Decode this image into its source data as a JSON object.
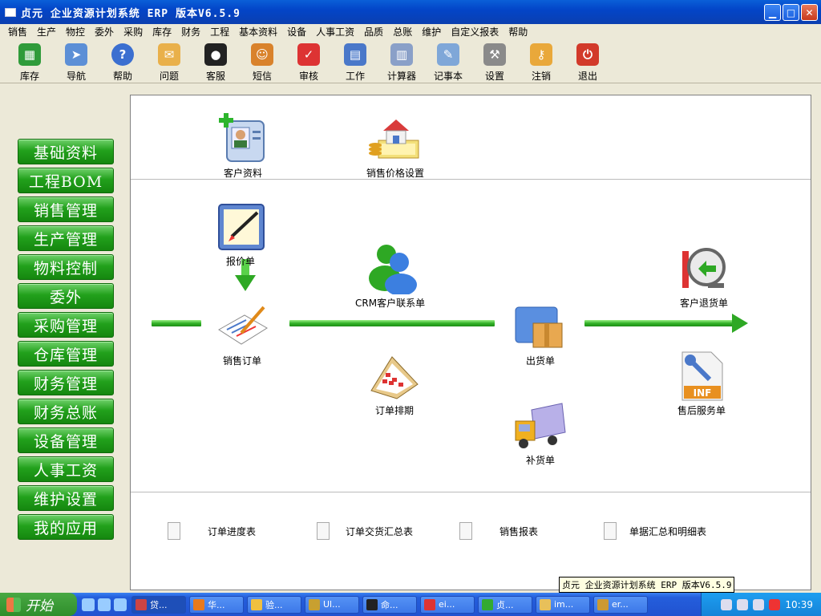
{
  "window": {
    "title": "贞元 企业资源计划系统 ERP 版本V6.5.9"
  },
  "menu": [
    "销售",
    "生产",
    "物控",
    "委外",
    "采购",
    "库存",
    "财务",
    "工程",
    "基本资料",
    "设备",
    "人事工资",
    "品质",
    "总账",
    "维护",
    "自定义报表",
    "帮助"
  ],
  "toolbar": [
    {
      "label": "库存",
      "icon": "inventory-icon",
      "color": "#2f9b3a"
    },
    {
      "label": "导航",
      "icon": "navigation-icon",
      "color": "#5c8fd6"
    },
    {
      "label": "帮助",
      "icon": "help-icon",
      "color": "#3b6fd0"
    },
    {
      "label": "问题",
      "icon": "envelope-icon",
      "color": "#e9b04a"
    },
    {
      "label": "客服",
      "icon": "qq-penguin-icon",
      "color": "#222222"
    },
    {
      "label": "短信",
      "icon": "people-icon",
      "color": "#d9822b"
    },
    {
      "label": "审核",
      "icon": "calendar-check-icon",
      "color": "#d33"
    },
    {
      "label": "工作",
      "icon": "calendar-icon",
      "color": "#4a78c9"
    },
    {
      "label": "计算器",
      "icon": "calculator-icon",
      "color": "#8aa0c8"
    },
    {
      "label": "记事本",
      "icon": "notepad-icon",
      "color": "#7fa7d8"
    },
    {
      "label": "设置",
      "icon": "tools-icon",
      "color": "#8a8a8a"
    },
    {
      "label": "注销",
      "icon": "key-icon",
      "color": "#e9a83a"
    },
    {
      "label": "退出",
      "icon": "power-icon",
      "color": "#d23a2a"
    }
  ],
  "nav": [
    "基础资料",
    "工程BOM",
    "销售管理",
    "生产管理",
    "物料控制",
    "委外",
    "采购管理",
    "仓库管理",
    "财务管理",
    "财务总账",
    "设备管理",
    "人事工资",
    "维护设置",
    "我的应用"
  ],
  "top_items": [
    {
      "label": "客户资料",
      "icon": "customer-card-icon"
    },
    {
      "label": "销售价格设置",
      "icon": "price-setting-icon"
    }
  ],
  "flow": {
    "quote": "报价单",
    "order": "销售订单",
    "crm": "CRM客户联系单",
    "schedule": "订单排期",
    "shipment": "出货单",
    "replenish": "补货单",
    "return": "客户退货单",
    "service": "售后服务单"
  },
  "reports": [
    "订单进度表",
    "订单交货汇总表",
    "销售报表",
    "单据汇总和明细表"
  ],
  "tooltip": "贞元 企业资源计划系统 ERP 版本V6.5.9",
  "taskbar": {
    "start": "开始",
    "tasks": [
      {
        "label": "贷...",
        "color": "#c44"
      },
      {
        "label": "华...",
        "color": "#e87a1e"
      },
      {
        "label": "验...",
        "color": "#f0c040"
      },
      {
        "label": "Ul...",
        "color": "#c8a030"
      },
      {
        "label": "命...",
        "color": "#222"
      },
      {
        "label": "ei...",
        "color": "#d33"
      },
      {
        "label": "贞...",
        "color": "#3a3"
      },
      {
        "label": "im...",
        "color": "#e8c05a"
      },
      {
        "label": "er...",
        "color": "#c93"
      }
    ],
    "clock": "10:39"
  }
}
